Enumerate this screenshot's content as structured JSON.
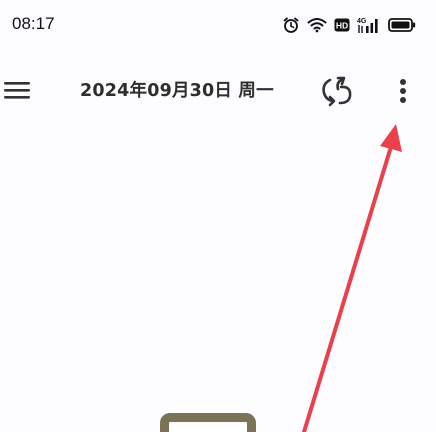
{
  "status_bar": {
    "time": "08:17",
    "icons": [
      "alarm-icon",
      "wifi-icon",
      "hd-icon",
      "signal-4g-icon",
      "battery-icon"
    ],
    "hd_label": "HD",
    "network_label": "4G"
  },
  "app_bar": {
    "menu_icon": "hamburger-menu-icon",
    "date_title": "2024年09月30日 周一",
    "sync_icon": "sync-icon",
    "more_icon": "more-vert-icon"
  },
  "annotation": {
    "arrow_color": "#e8414c"
  },
  "bottom_element": {
    "border_color": "#7b7356"
  }
}
